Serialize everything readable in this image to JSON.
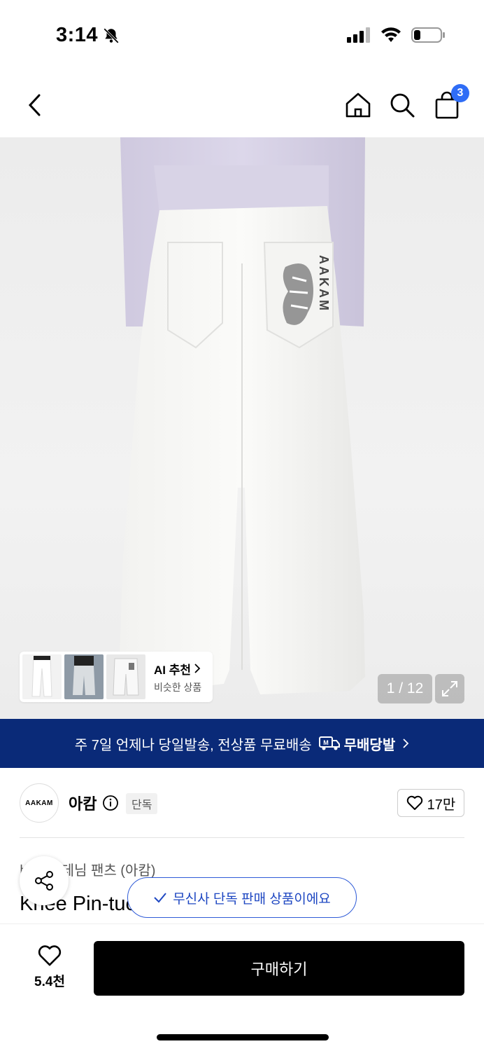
{
  "status": {
    "time": "3:14",
    "battery_level": 0.25
  },
  "header": {
    "badge_count": "3"
  },
  "hero": {
    "pocket_text": "AAKAM",
    "ai_title": "AI 추천",
    "ai_subtitle": "비슷한 상품",
    "counter": "1 / 12"
  },
  "banner": {
    "text": "주 7일 언제나 당일발송, 전상품 무료배송",
    "free_label": "무배당발"
  },
  "brand": {
    "logo_text": "AAKAM",
    "name": "아캄",
    "exclusive": "단독",
    "likes": "17만"
  },
  "product": {
    "breadcrumb": "바지 > 데님 팬츠 (아캄)",
    "title": "Knee Pin-tuck Denim Pants (White)"
  },
  "toast": {
    "text": "무신사 단독 판매 상품이에요"
  },
  "bottom": {
    "likes": "5.4천",
    "buy_label": "구매하기"
  },
  "colors": {
    "banner": "#0a2a78",
    "accent": "#2f6df6",
    "toast": "#1e47c2"
  }
}
